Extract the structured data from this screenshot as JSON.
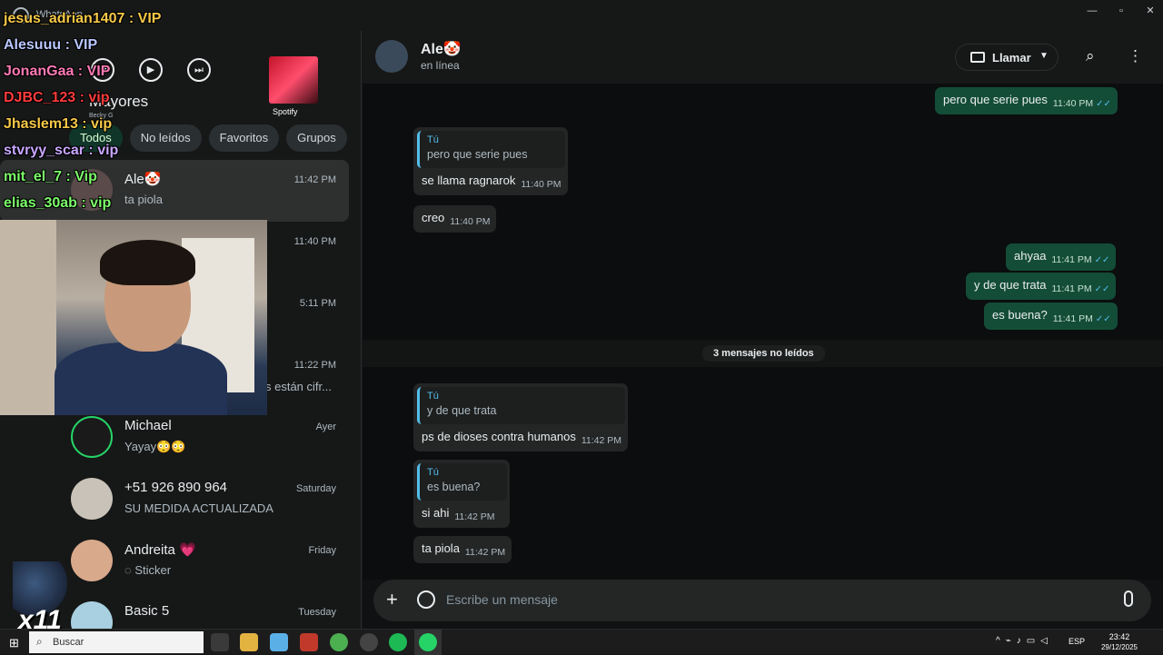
{
  "window": {
    "app_title": "WhatsApp",
    "minimize": "—",
    "maximize": "▫",
    "close": "✕"
  },
  "media": {
    "song_title": "Mayores",
    "artist": "Becky G",
    "source": "Spotify",
    "prev": "⏮",
    "play": "▶",
    "next": "⏭"
  },
  "filters": [
    "Todos",
    "No leídos",
    "Favoritos",
    "Grupos"
  ],
  "chats": [
    {
      "name": "Ale🤡",
      "preview": "ta piola",
      "time": "11:42 PM",
      "selected": true
    },
    {
      "name": "",
      "preview": "",
      "time": "11:40 PM"
    },
    {
      "name": "",
      "preview": "",
      "time": "5:11 PM"
    },
    {
      "name": "",
      "preview": "s están cifr...",
      "time": "11:22 PM"
    },
    {
      "name": "Michael",
      "preview": "Yayay😳😳",
      "time": "Ayer"
    },
    {
      "name": "+51 926 890 964",
      "preview": "SU MEDIDA ACTUALIZADA",
      "time": "Saturday"
    },
    {
      "name": "Andreita 💗",
      "preview": "Sticker",
      "time": "Friday"
    },
    {
      "name": "Basic 5",
      "preview": "",
      "time": "Tuesday"
    }
  ],
  "stream_chat": [
    "jesus_adrian1407 : VIP",
    "Alesuuu : VIP",
    "JonanGaa : VIP",
    "DJBC_123 : vip",
    "Jhaslem13 : vip",
    "stvryy_scar : vip",
    "mit_el_7 : Vip",
    "elias_30ab : vip"
  ],
  "stream_badge": "x11",
  "header": {
    "contact_name": "Ale🤡",
    "status": "en línea",
    "call_label": "Llamar"
  },
  "messages": [
    {
      "dir": "out",
      "text": "pero que serie pues",
      "time": "11:40 PM"
    },
    {
      "dir": "in",
      "quote_author": "Tú",
      "quote_text": "pero que serie pues",
      "text": "se llama ragnarok",
      "time": "11:40 PM"
    },
    {
      "dir": "in",
      "text": "creo",
      "time": "11:40 PM"
    },
    {
      "dir": "out",
      "text": "ahyaa",
      "time": "11:41 PM"
    },
    {
      "dir": "out",
      "text": "y de que trata",
      "time": "11:41 PM"
    },
    {
      "dir": "out",
      "text": "es buena?",
      "time": "11:41 PM"
    },
    {
      "dir": "in",
      "quote_author": "Tú",
      "quote_text": "y de que trata",
      "text": "ps de dioses contra humanos",
      "time": "11:42 PM"
    },
    {
      "dir": "in",
      "quote_author": "Tú",
      "quote_text": "es buena?",
      "text": "si ahi",
      "time": "11:42 PM"
    },
    {
      "dir": "in",
      "text": "ta piola",
      "time": "11:42 PM"
    }
  ],
  "unread_divider": "3 mensajes no leídos",
  "composer": {
    "placeholder": "Escribe un mensaje"
  },
  "taskbar": {
    "search_label": "Buscar",
    "lang": "ESP",
    "time": "23:42",
    "date": "29/12/2025"
  },
  "colors": {
    "accent": "#25d366",
    "out_bubble": "#144d37",
    "in_bubble": "#242626",
    "ticks": "#53bdeb"
  }
}
